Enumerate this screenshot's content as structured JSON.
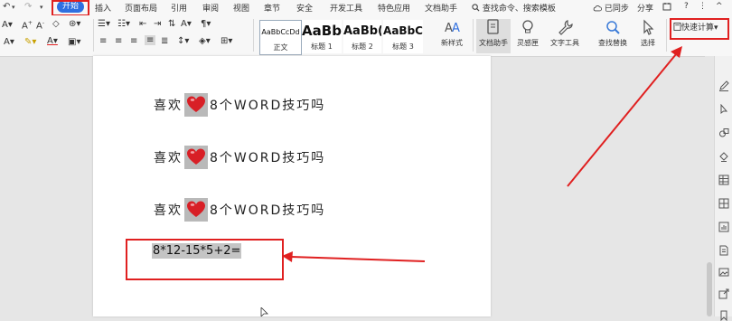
{
  "quick_access": {
    "undo": "↶",
    "undo_arrow": "▾",
    "redo": "↷",
    "customize": "▾"
  },
  "menu": {
    "start": "开始",
    "tabs": [
      "插入",
      "页面布局",
      "引用",
      "审阅",
      "视图",
      "章节",
      "安全",
      "开发工具",
      "特色应用",
      "文档助手"
    ],
    "search": "查找命令、搜索模板",
    "sync": "已同步",
    "share": "分享",
    "help": "?",
    "more": "⋮",
    "collapse": "^"
  },
  "ribbon": {
    "styles": [
      {
        "sample": "AaBbCcDd",
        "name": "正文"
      },
      {
        "sample": "AaBb",
        "name": "标题 1"
      },
      {
        "sample": "AaBb(",
        "name": "标题 2"
      },
      {
        "sample": "AaBbC",
        "name": "标题 3"
      }
    ],
    "new_style": "新样式",
    "tools": [
      "文档助手",
      "灵感匣",
      "文字工具",
      "查找替换",
      "选择"
    ],
    "quick_calc": "快速计算"
  },
  "document": {
    "lines": [
      {
        "before": "喜欢",
        "after": "8个WORD技巧吗"
      },
      {
        "before": "喜欢",
        "after": "8个WORD技巧吗"
      },
      {
        "before": "喜欢",
        "after": "8个WORD技巧吗"
      }
    ],
    "formula": "8*12-15*5+2="
  },
  "colors": {
    "accent": "#2f6fe0",
    "annotation": "#e02020"
  }
}
